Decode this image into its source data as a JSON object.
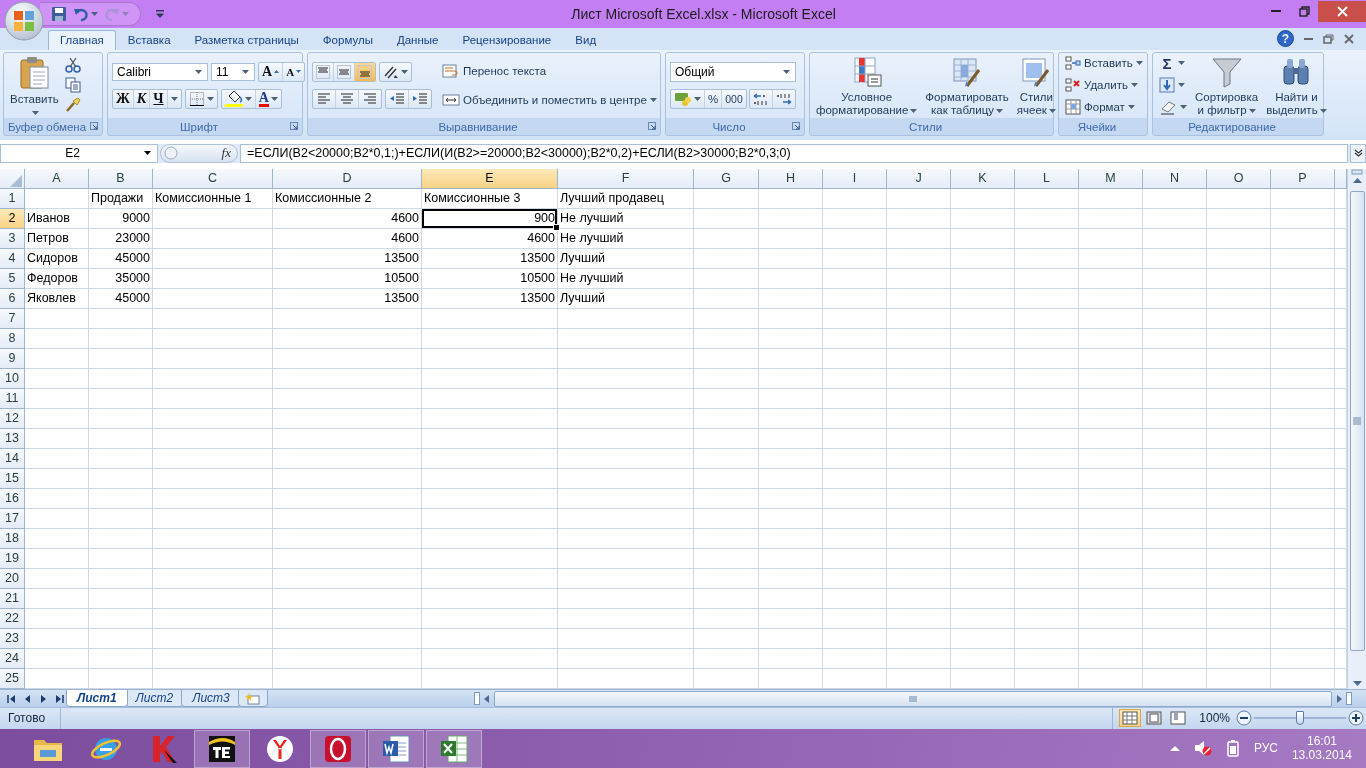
{
  "window": {
    "title": "Лист Microsoft Excel.xlsx - Microsoft Excel"
  },
  "ribbon": {
    "tabs": [
      {
        "label": "Главная",
        "selected": true
      },
      {
        "label": "Вставка",
        "selected": false
      },
      {
        "label": "Разметка страницы",
        "selected": false
      },
      {
        "label": "Формулы",
        "selected": false
      },
      {
        "label": "Данные",
        "selected": false
      },
      {
        "label": "Рецензирование",
        "selected": false
      },
      {
        "label": "Вид",
        "selected": false
      }
    ],
    "help": "?",
    "clipboard": {
      "label": "Буфер обмена",
      "paste": "Вставить"
    },
    "font": {
      "label": "Шрифт",
      "font_name": "Calibri",
      "font_size": "11",
      "grow": "A",
      "shrink": "A",
      "bold": "Ж",
      "italic": "К",
      "underline": "Ч",
      "font_color": "A"
    },
    "alignment": {
      "label": "Выравнивание",
      "vertical": [
        {
          "selected": false
        },
        {
          "selected": false
        },
        {
          "selected": true
        }
      ],
      "wrap_text": "Перенос текста",
      "merge_center": "Объединить и поместить в центре"
    },
    "number": {
      "label": "Число",
      "format": "Общий",
      "percent": "%",
      "thousands": "000"
    },
    "styles": {
      "label": "Стили",
      "buttons": [
        [
          "Условное",
          "форматирование"
        ],
        [
          "Форматировать",
          "как таблицу"
        ],
        [
          "Стили",
          "ячеек"
        ]
      ]
    },
    "cells": {
      "label": "Ячейки",
      "buttons": [
        "Вставить",
        "Удалить",
        "Формат"
      ]
    },
    "editing": {
      "label": "Редактирование",
      "sum": "Σ",
      "buttons": [
        [
          "Сортировка",
          "и фильтр"
        ],
        [
          "Найти и",
          "выделить"
        ]
      ]
    }
  },
  "formula_bar": {
    "name_box": "E2",
    "function_label": "fx",
    "formula": "=ЕСЛИ(B2<20000;B2*0,1;)+ЕСЛИ(И(B2>=20000;B2<30000);B2*0,2)+ЕСЛИ(B2>30000;B2*0,3;0)"
  },
  "sheet": {
    "columns": [
      {
        "label": "A",
        "selected": false
      },
      {
        "label": "B",
        "selected": false
      },
      {
        "label": "C",
        "selected": false
      },
      {
        "label": "D",
        "selected": false
      },
      {
        "label": "E",
        "selected": true
      },
      {
        "label": "F",
        "selected": false
      },
      {
        "label": "G",
        "selected": false
      },
      {
        "label": "H",
        "selected": false
      },
      {
        "label": "I",
        "selected": false
      },
      {
        "label": "J",
        "selected": false
      },
      {
        "label": "K",
        "selected": false
      },
      {
        "label": "L",
        "selected": false
      },
      {
        "label": "M",
        "selected": false
      },
      {
        "label": "N",
        "selected": false
      },
      {
        "label": "O",
        "selected": false
      },
      {
        "label": "P",
        "selected": false
      }
    ],
    "rows": [
      {
        "label": "1",
        "selected": false,
        "cells": [
          null,
          {
            "value": "Продажи",
            "kind": "text",
            "selected": false
          },
          {
            "value": "Комиссионные 1",
            "kind": "text",
            "selected": false
          },
          {
            "value": "Комиссионные 2",
            "kind": "text",
            "selected": false
          },
          {
            "value": "Комиссионные 3",
            "kind": "text",
            "selected": false
          },
          {
            "value": "Лучший продавец",
            "kind": "text",
            "selected": false
          }
        ]
      },
      {
        "label": "2",
        "selected": true,
        "cells": [
          {
            "value": "Иванов",
            "kind": "text",
            "selected": false
          },
          {
            "value": "9000",
            "kind": "number",
            "selected": false
          },
          null,
          {
            "value": "4600",
            "kind": "number",
            "selected": false
          },
          {
            "value": "900",
            "kind": "number",
            "selected": true
          },
          {
            "value": "Не лучший",
            "kind": "text",
            "selected": false
          }
        ]
      },
      {
        "label": "3",
        "selected": false,
        "cells": [
          {
            "value": "Петров",
            "kind": "text",
            "selected": false
          },
          {
            "value": "23000",
            "kind": "number",
            "selected": false
          },
          null,
          {
            "value": "4600",
            "kind": "number",
            "selected": false
          },
          {
            "value": "4600",
            "kind": "number",
            "selected": false
          },
          {
            "value": "Не лучший",
            "kind": "text",
            "selected": false
          }
        ]
      },
      {
        "label": "4",
        "selected": false,
        "cells": [
          {
            "value": "Сидоров",
            "kind": "text",
            "selected": false
          },
          {
            "value": "45000",
            "kind": "number",
            "selected": false
          },
          null,
          {
            "value": "13500",
            "kind": "number",
            "selected": false
          },
          {
            "value": "13500",
            "kind": "number",
            "selected": false
          },
          {
            "value": "Лучший",
            "kind": "text",
            "selected": false
          }
        ]
      },
      {
        "label": "5",
        "selected": false,
        "cells": [
          {
            "value": "Федоров",
            "kind": "text",
            "selected": false
          },
          {
            "value": "35000",
            "kind": "number",
            "selected": false
          },
          null,
          {
            "value": "10500",
            "kind": "number",
            "selected": false
          },
          {
            "value": "10500",
            "kind": "number",
            "selected": false
          },
          {
            "value": "Не лучший",
            "kind": "text",
            "selected": false
          }
        ]
      },
      {
        "label": "6",
        "selected": false,
        "cells": [
          {
            "value": "Яковлев",
            "kind": "text",
            "selected": false
          },
          {
            "value": "45000",
            "kind": "number",
            "selected": false
          },
          null,
          {
            "value": "13500",
            "kind": "number",
            "selected": false
          },
          {
            "value": "13500",
            "kind": "number",
            "selected": false
          },
          {
            "value": "Лучший",
            "kind": "text",
            "selected": false
          }
        ]
      },
      {
        "label": "7",
        "selected": false
      },
      {
        "label": "8",
        "selected": false
      },
      {
        "label": "9",
        "selected": false
      },
      {
        "label": "10",
        "selected": false
      },
      {
        "label": "11",
        "selected": false
      },
      {
        "label": "12",
        "selected": false
      },
      {
        "label": "13",
        "selected": false
      },
      {
        "label": "14",
        "selected": false
      },
      {
        "label": "15",
        "selected": false
      },
      {
        "label": "16",
        "selected": false
      },
      {
        "label": "17",
        "selected": false
      },
      {
        "label": "18",
        "selected": false
      },
      {
        "label": "19",
        "selected": false
      },
      {
        "label": "20",
        "selected": false
      },
      {
        "label": "21",
        "selected": false
      },
      {
        "label": "22",
        "selected": false
      },
      {
        "label": "23",
        "selected": false
      },
      {
        "label": "24",
        "selected": false
      },
      {
        "label": "25",
        "selected": false
      }
    ]
  },
  "sheet_tabs": [
    {
      "label": "Лист1",
      "selected": true
    },
    {
      "label": "Лист2",
      "selected": false
    },
    {
      "label": "Лист3",
      "selected": false
    }
  ],
  "status_bar": {
    "status": "Готово",
    "views": [
      {
        "selected": true
      },
      {
        "selected": false
      },
      {
        "selected": false
      }
    ],
    "zoom": "100%",
    "zoom_slider": {
      "level": 0.5
    }
  },
  "taskbar": {
    "apps": [
      {
        "running": false
      },
      {
        "running": false
      },
      {
        "running": false
      },
      {
        "running": true
      },
      {
        "running": false
      },
      {
        "running": true
      },
      {
        "running": true
      },
      {
        "running": true
      }
    ],
    "language": "РУС",
    "time": "16:01",
    "date": "13.03.2014"
  }
}
